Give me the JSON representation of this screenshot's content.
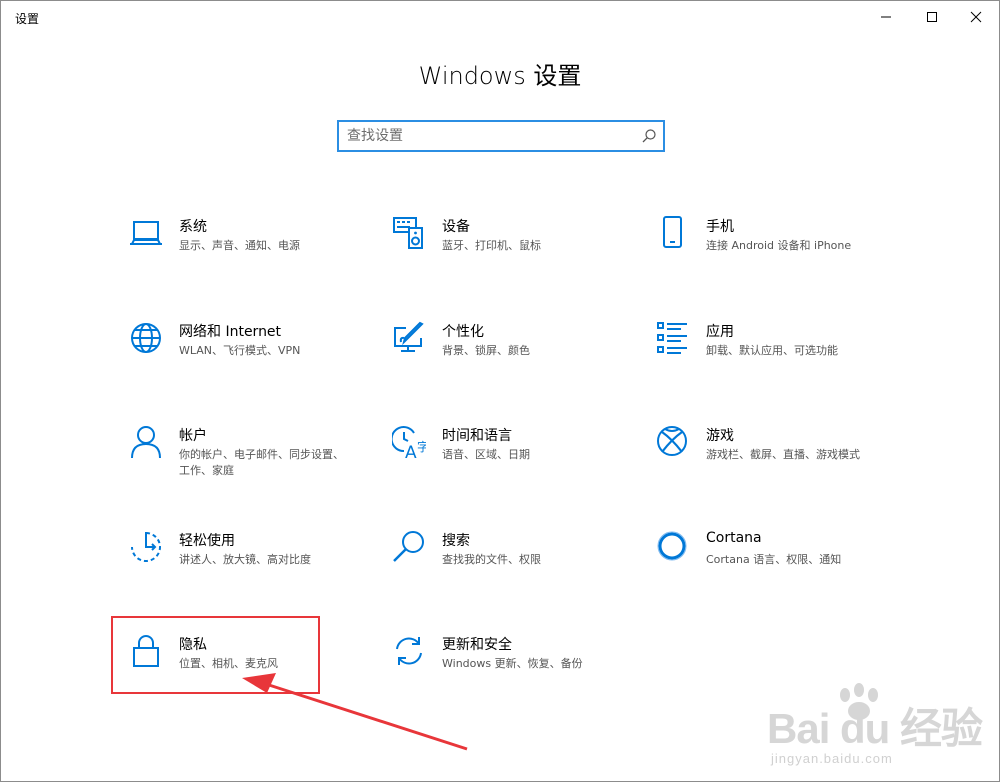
{
  "window": {
    "title": "设置",
    "controls": [
      "minimize-icon",
      "maximize-icon",
      "close-icon"
    ]
  },
  "header": {
    "title": "Windows 设置"
  },
  "search": {
    "placeholder": "查找设置",
    "value": ""
  },
  "tiles": [
    {
      "icon": "laptop-icon",
      "name": "系统",
      "desc": "显示、声音、通知、电源"
    },
    {
      "icon": "keyboard-speaker-icon",
      "name": "设备",
      "desc": "蓝牙、打印机、鼠标"
    },
    {
      "icon": "phone-icon",
      "name": "手机",
      "desc": "连接 Android 设备和 iPhone"
    },
    {
      "icon": "globe-icon",
      "name": "网络和 Internet",
      "desc": "WLAN、飞行模式、VPN"
    },
    {
      "icon": "paint-monitor-icon",
      "name": "个性化",
      "desc": "背景、锁屏、颜色"
    },
    {
      "icon": "apps-list-icon",
      "name": "应用",
      "desc": "卸载、默认应用、可选功能"
    },
    {
      "icon": "person-icon",
      "name": "帐户",
      "desc": "你的帐户、电子邮件、同步设置、工作、家庭"
    },
    {
      "icon": "time-language-icon",
      "name": "时间和语言",
      "desc": "语音、区域、日期"
    },
    {
      "icon": "xbox-icon",
      "name": "游戏",
      "desc": "游戏栏、截屏、直播、游戏模式"
    },
    {
      "icon": "ease-of-access-icon",
      "name": "轻松使用",
      "desc": "讲述人、放大镜、高对比度"
    },
    {
      "icon": "search-magnifier-icon",
      "name": "搜索",
      "desc": "查找我的文件、权限"
    },
    {
      "icon": "cortana-icon",
      "name": "Cortana",
      "desc": "Cortana 语言、权限、通知"
    },
    {
      "icon": "lock-icon",
      "name": "隐私",
      "desc": "位置、相机、麦克风"
    },
    {
      "icon": "sync-arrows-icon",
      "name": "更新和安全",
      "desc": "Windows 更新、恢复、备份"
    }
  ],
  "annotation": {
    "highlight_color": "#e8363a",
    "target": "隐私"
  },
  "watermark": {
    "text": "Bai du 经验",
    "url": "jingyan.baidu.com"
  },
  "colors": {
    "accent": "#0078d7",
    "search_border": "#2b8ee3"
  }
}
